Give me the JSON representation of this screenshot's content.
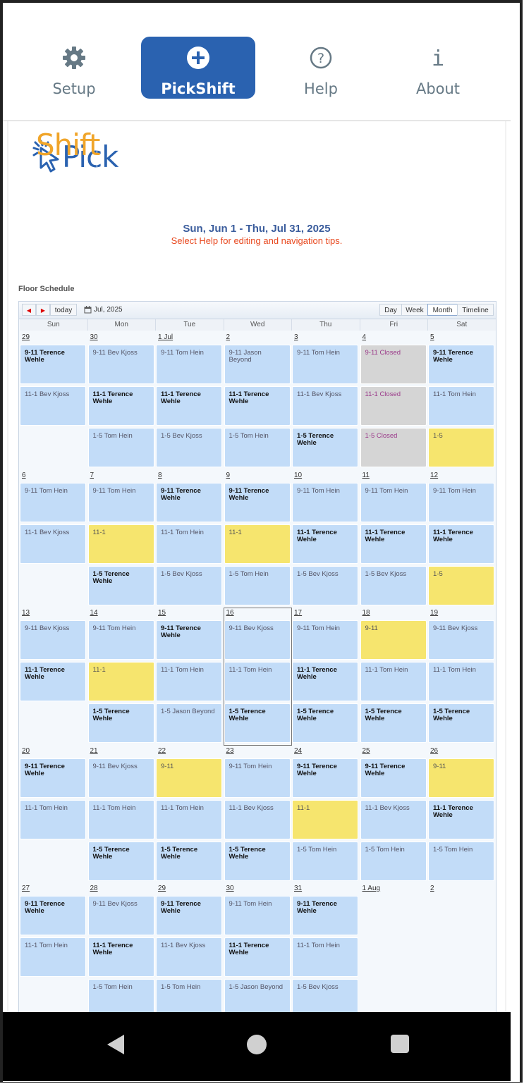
{
  "nav": {
    "items": [
      {
        "label": "Setup",
        "icon": "gear-icon"
      },
      {
        "label": "PickShift",
        "icon": "plus-circle-icon",
        "active": true
      },
      {
        "label": "Help",
        "icon": "question-circle-icon"
      },
      {
        "label": "About",
        "icon": "info-icon"
      }
    ]
  },
  "logo": {
    "pick": "Pick",
    "shift": "Shift"
  },
  "header": {
    "range": "Sun, Jun 1 - Thu, Jul 31, 2025",
    "hint": "Select Help for editing and navigation tips."
  },
  "schedule_label": "Floor Schedule",
  "toolbar": {
    "prev": "◀",
    "next": "▶",
    "today": "today",
    "current": "Jul, 2025",
    "views": [
      "Day",
      "Week",
      "Month",
      "Timeline"
    ],
    "selected_view": "Month"
  },
  "weekdays": [
    "Sun",
    "Mon",
    "Tue",
    "Wed",
    "Thu",
    "Fri",
    "Sat"
  ],
  "weeks": [
    {
      "days": [
        "29",
        "30",
        "1 Jul",
        "2",
        "3",
        "4",
        "5"
      ],
      "rows": [
        [
          {
            "t": "9-11 Terence Wehle",
            "c": "blue",
            "b": true
          },
          {
            "t": "9-11 Bev Kjoss",
            "c": "blue"
          },
          {
            "t": "9-11 Tom Hein",
            "c": "blue"
          },
          {
            "t": "9-11 Jason Beyond",
            "c": "blue"
          },
          {
            "t": "9-11 Tom Hein",
            "c": "blue"
          },
          {
            "t": "9-11 Closed",
            "c": "gray"
          },
          {
            "t": "9-11 Terence Wehle",
            "c": "blue",
            "b": true
          }
        ],
        [
          {
            "t": "11-1 Bev Kjoss",
            "c": "blue"
          },
          {
            "t": "11-1 Terence Wehle",
            "c": "blue",
            "b": true
          },
          {
            "t": "11-1 Terence Wehle",
            "c": "blue",
            "b": true
          },
          {
            "t": "11-1 Terence Wehle",
            "c": "blue",
            "b": true
          },
          {
            "t": "11-1 Bev Kjoss",
            "c": "blue"
          },
          {
            "t": "11-1 Closed",
            "c": "gray"
          },
          {
            "t": "11-1 Tom Hein",
            "c": "blue"
          }
        ],
        [
          null,
          {
            "t": "1-5 Tom Hein",
            "c": "blue"
          },
          {
            "t": "1-5 Bev Kjoss",
            "c": "blue"
          },
          {
            "t": "1-5 Tom Hein",
            "c": "blue"
          },
          {
            "t": "1-5 Terence Wehle",
            "c": "blue",
            "b": true
          },
          {
            "t": "1-5 Closed",
            "c": "gray"
          },
          {
            "t": "1-5",
            "c": "yellow"
          }
        ]
      ]
    },
    {
      "days": [
        "6",
        "7",
        "8",
        "9",
        "10",
        "11",
        "12"
      ],
      "rows": [
        [
          {
            "t": "9-11 Tom Hein",
            "c": "blue"
          },
          {
            "t": "9-11 Tom Hein",
            "c": "blue"
          },
          {
            "t": "9-11 Terence Wehle",
            "c": "blue",
            "b": true
          },
          {
            "t": "9-11 Terence Wehle",
            "c": "blue",
            "b": true
          },
          {
            "t": "9-11 Tom Hein",
            "c": "blue"
          },
          {
            "t": "9-11 Tom Hein",
            "c": "blue"
          },
          {
            "t": "9-11 Tom Hein",
            "c": "blue"
          }
        ],
        [
          {
            "t": "11-1 Bev Kjoss",
            "c": "blue"
          },
          {
            "t": "11-1",
            "c": "yellow"
          },
          {
            "t": "11-1 Tom Hein",
            "c": "blue"
          },
          {
            "t": "11-1",
            "c": "yellow"
          },
          {
            "t": "11-1 Terence Wehle",
            "c": "blue",
            "b": true
          },
          {
            "t": "11-1 Terence Wehle",
            "c": "blue",
            "b": true
          },
          {
            "t": "11-1 Terence Wehle",
            "c": "blue",
            "b": true
          }
        ],
        [
          null,
          {
            "t": "1-5 Terence Wehle",
            "c": "blue",
            "b": true
          },
          {
            "t": "1-5 Bev Kjoss",
            "c": "blue"
          },
          {
            "t": "1-5 Tom Hein",
            "c": "blue"
          },
          {
            "t": "1-5 Bev Kjoss",
            "c": "blue"
          },
          {
            "t": "1-5 Bev Kjoss",
            "c": "blue"
          },
          {
            "t": "1-5",
            "c": "yellow"
          }
        ]
      ]
    },
    {
      "days": [
        "13",
        "14",
        "15",
        "16",
        "17",
        "18",
        "19"
      ],
      "rows": [
        [
          {
            "t": "9-11 Bev Kjoss",
            "c": "blue"
          },
          {
            "t": "9-11 Tom Hein",
            "c": "blue"
          },
          {
            "t": "9-11 Terence Wehle",
            "c": "blue",
            "b": true
          },
          {
            "t": "9-11 Bev Kjoss",
            "c": "blue"
          },
          {
            "t": "9-11 Tom Hein",
            "c": "blue"
          },
          {
            "t": "9-11",
            "c": "yellow"
          },
          {
            "t": "9-11 Bev Kjoss",
            "c": "blue"
          }
        ],
        [
          {
            "t": "11-1 Terence Wehle",
            "c": "blue",
            "b": true
          },
          {
            "t": "11-1",
            "c": "yellow"
          },
          {
            "t": "11-1 Tom Hein",
            "c": "blue"
          },
          {
            "t": "11-1 Tom Hein",
            "c": "blue"
          },
          {
            "t": "11-1 Terence Wehle",
            "c": "blue",
            "b": true
          },
          {
            "t": "11-1 Tom Hein",
            "c": "blue"
          },
          {
            "t": "11-1 Tom Hein",
            "c": "blue"
          }
        ],
        [
          null,
          {
            "t": "1-5 Terence Wehle",
            "c": "blue",
            "b": true
          },
          {
            "t": "1-5 Jason Beyond",
            "c": "blue"
          },
          {
            "t": "1-5 Terence Wehle",
            "c": "blue",
            "b": true
          },
          {
            "t": "1-5 Terence Wehle",
            "c": "blue",
            "b": true
          },
          {
            "t": "1-5 Terence Wehle",
            "c": "blue",
            "b": true
          },
          {
            "t": "1-5 Terence Wehle",
            "c": "blue",
            "b": true
          }
        ]
      ]
    },
    {
      "days": [
        "20",
        "21",
        "22",
        "23",
        "24",
        "25",
        "26"
      ],
      "rows": [
        [
          {
            "t": "9-11 Terence Wehle",
            "c": "blue",
            "b": true
          },
          {
            "t": "9-11 Bev Kjoss",
            "c": "blue"
          },
          {
            "t": "9-11",
            "c": "yellow"
          },
          {
            "t": "9-11 Tom Hein",
            "c": "blue"
          },
          {
            "t": "9-11 Terence Wehle",
            "c": "blue",
            "b": true
          },
          {
            "t": "9-11 Terence Wehle",
            "c": "blue",
            "b": true
          },
          {
            "t": "9-11",
            "c": "yellow"
          }
        ],
        [
          {
            "t": "11-1 Tom Hein",
            "c": "blue"
          },
          {
            "t": "11-1 Tom Hein",
            "c": "blue"
          },
          {
            "t": "11-1 Tom Hein",
            "c": "blue"
          },
          {
            "t": "11-1 Bev Kjoss",
            "c": "blue"
          },
          {
            "t": "11-1",
            "c": "yellow"
          },
          {
            "t": "11-1 Bev Kjoss",
            "c": "blue"
          },
          {
            "t": "11-1 Terence Wehle",
            "c": "blue",
            "b": true
          }
        ],
        [
          null,
          {
            "t": "1-5 Terence Wehle",
            "c": "blue",
            "b": true
          },
          {
            "t": "1-5 Terence Wehle",
            "c": "blue",
            "b": true
          },
          {
            "t": "1-5 Terence Wehle",
            "c": "blue",
            "b": true
          },
          {
            "t": "1-5 Tom Hein",
            "c": "blue"
          },
          {
            "t": "1-5 Tom Hein",
            "c": "blue"
          },
          {
            "t": "1-5 Tom Hein",
            "c": "blue"
          }
        ]
      ]
    },
    {
      "days": [
        "27",
        "28",
        "29",
        "30",
        "31",
        "1 Aug",
        "2"
      ],
      "rows": [
        [
          {
            "t": "9-11 Terence Wehle",
            "c": "blue",
            "b": true
          },
          {
            "t": "9-11 Bev Kjoss",
            "c": "blue"
          },
          {
            "t": "9-11 Terence Wehle",
            "c": "blue",
            "b": true
          },
          {
            "t": "9-11 Tom Hein",
            "c": "blue"
          },
          {
            "t": "9-11 Terence Wehle",
            "c": "blue",
            "b": true
          },
          null,
          null
        ],
        [
          {
            "t": "11-1 Tom Hein",
            "c": "blue"
          },
          {
            "t": "11-1 Terence Wehle",
            "c": "blue",
            "b": true
          },
          {
            "t": "11-1 Bev Kjoss",
            "c": "blue"
          },
          {
            "t": "11-1 Terence Wehle",
            "c": "blue",
            "b": true
          },
          {
            "t": "11-1 Tom Hein",
            "c": "blue"
          },
          null,
          null
        ],
        [
          null,
          {
            "t": "1-5 Tom Hein",
            "c": "blue"
          },
          {
            "t": "1-5 Tom Hein",
            "c": "blue"
          },
          {
            "t": "1-5 Jason Beyond",
            "c": "blue"
          },
          {
            "t": "1-5 Bev Kjoss",
            "c": "blue"
          },
          null,
          null
        ]
      ]
    }
  ],
  "today": "16",
  "colors": {
    "brand": "#2a62b0",
    "accent": "#f0a52a",
    "shift_blue": "#c2dcf8",
    "shift_yellow": "#f6e56e",
    "shift_gray": "#d5d5d5"
  },
  "bottom_nav": {
    "icons": [
      "back-triangle-icon",
      "home-circle-icon",
      "recents-square-icon"
    ]
  }
}
